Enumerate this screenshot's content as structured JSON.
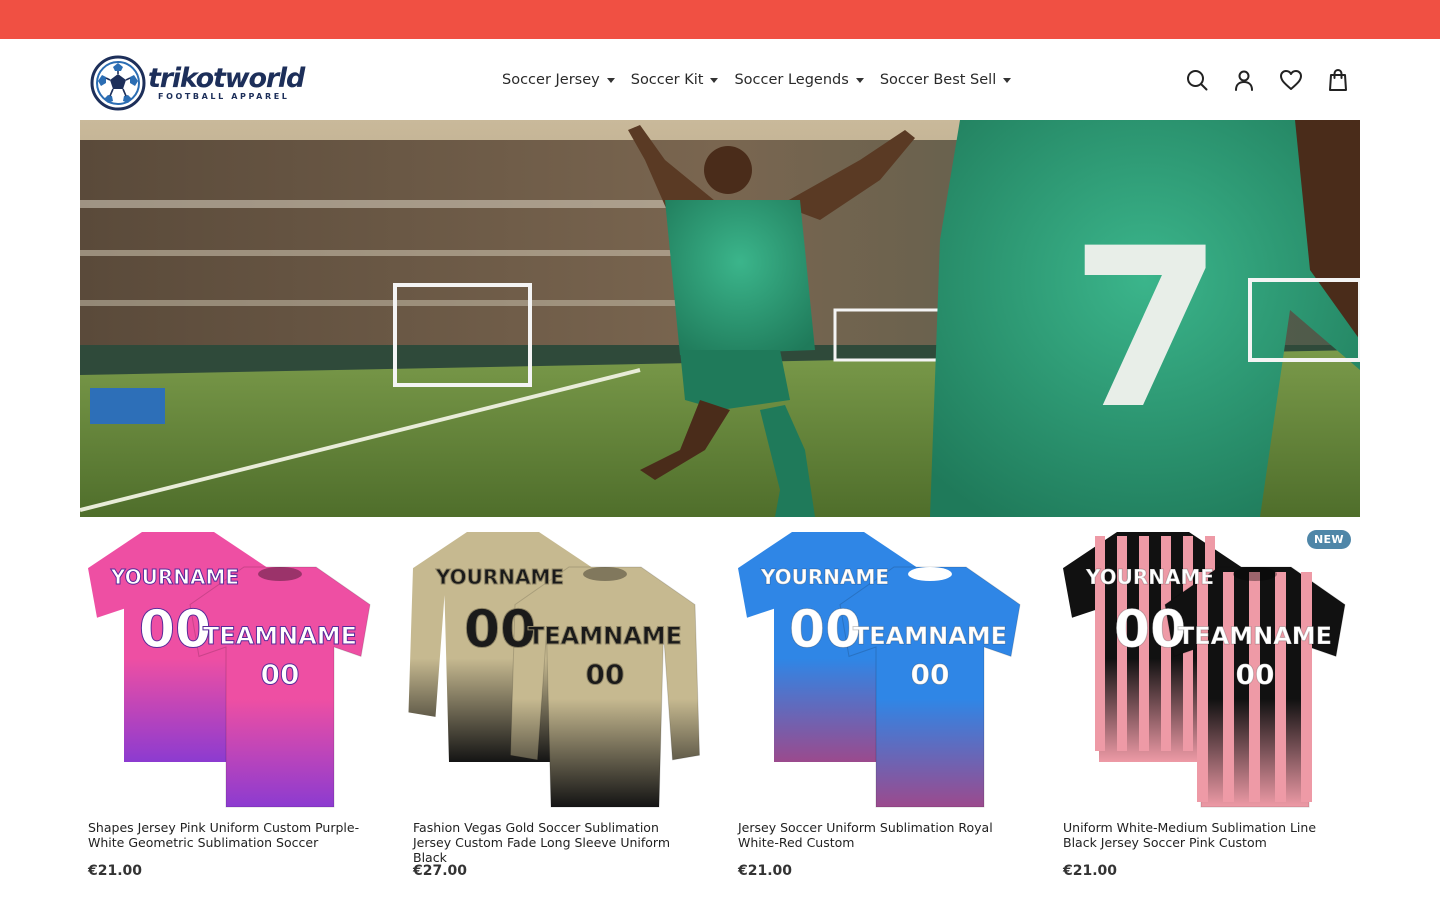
{
  "brand": {
    "name": "trikotworld",
    "tagline": "FOOTBALL APPAREL",
    "color": "#1d2f5a"
  },
  "announcement_bar": {
    "color": "#f05043"
  },
  "nav": {
    "items": [
      {
        "label": "Soccer Jersey"
      },
      {
        "label": "Soccer Kit"
      },
      {
        "label": "Soccer Legends"
      },
      {
        "label": "Soccer Best Sell"
      }
    ]
  },
  "header_icons": [
    "search-icon",
    "account-icon",
    "wishlist-heart-icon",
    "cart-bag-icon"
  ],
  "hero": {
    "jersey_number": "7",
    "jersey_color": "#2fa37c"
  },
  "products": [
    {
      "title": "Shapes Jersey Pink Uniform Custom Purple-White Geometric Sublimation Soccer",
      "price": "€21.00",
      "print_back_name": "YOURNAME",
      "print_back_number": "00",
      "print_front_name": "TEAMNAME",
      "print_front_number": "00",
      "colors": [
        "#ee4fa3",
        "#8c3bd0",
        "#f7a93c"
      ]
    },
    {
      "title": "Fashion Vegas Gold Soccer Sublimation Jersey Custom Fade Long Sleeve Uniform Black",
      "price": "€27.00",
      "print_back_name": "YOURNAME",
      "print_back_number": "00",
      "print_front_name": "TEAMNAME",
      "print_front_number": "00",
      "colors": [
        "#c6b990",
        "#141414",
        "#8e8465"
      ]
    },
    {
      "title": "Jersey Soccer Uniform Sublimation Royal White-Red Custom",
      "price": "€21.00",
      "print_back_name": "YOURNAME",
      "print_back_number": "00",
      "print_front_name": "TEAMNAME",
      "print_front_number": "00",
      "colors": [
        "#2f86e6",
        "#9b4a8d",
        "#ffffff"
      ]
    },
    {
      "title": "Uniform White-Medium Sublimation Line Black Jersey Soccer Pink Custom",
      "price": "€21.00",
      "badge": "NEW",
      "print_back_name": "YOURNAME",
      "print_back_number": "00",
      "print_front_name": "TEAMNAME",
      "print_front_number": "00",
      "colors": [
        "#111111",
        "#ee9aa6",
        "#f3d0d4"
      ]
    }
  ]
}
